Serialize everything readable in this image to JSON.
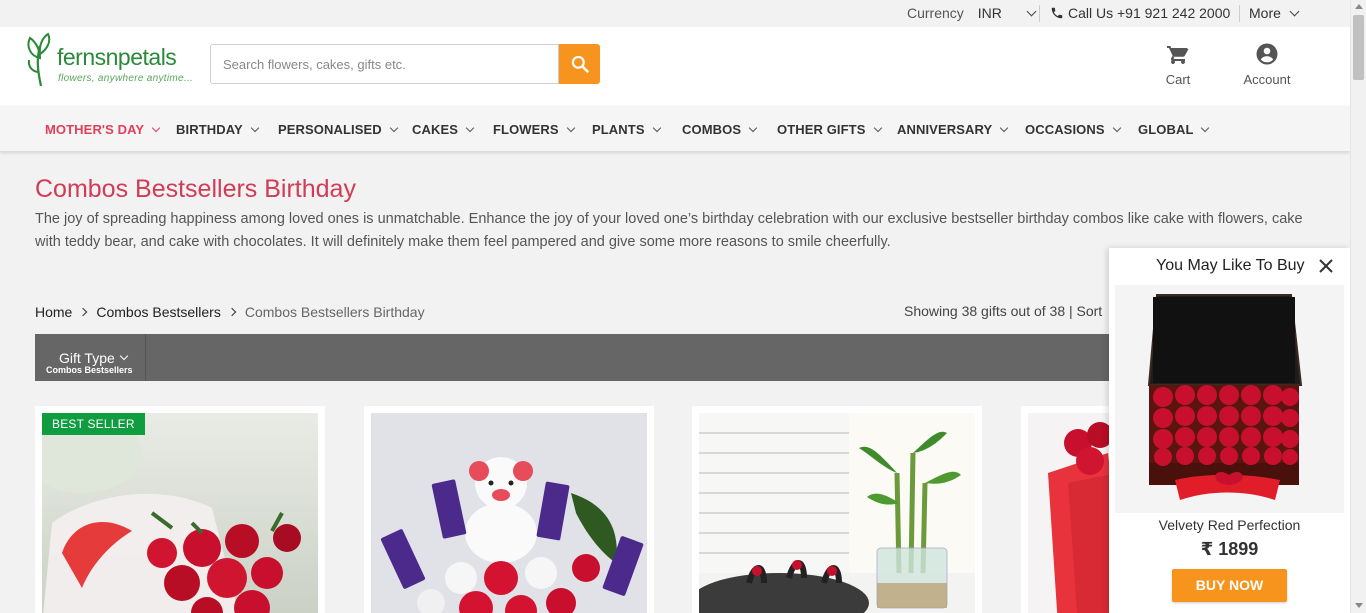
{
  "topbar": {
    "currency_label": "Currency",
    "currency_value": "INR",
    "call_label": "Call Us +91 921 242 2000",
    "more_label": "More"
  },
  "header": {
    "logo_brand": "fernsnpetals",
    "logo_tagline": "flowers, anywhere anytime...",
    "search_placeholder": "Search flowers, cakes, gifts etc.",
    "cart_label": "Cart",
    "account_label": "Account"
  },
  "nav": {
    "items": [
      {
        "label": "MOTHER'S DAY"
      },
      {
        "label": "BIRTHDAY"
      },
      {
        "label": "PERSONALISED"
      },
      {
        "label": "CAKES"
      },
      {
        "label": "FLOWERS"
      },
      {
        "label": "PLANTS"
      },
      {
        "label": "COMBOS"
      },
      {
        "label": "OTHER GIFTS"
      },
      {
        "label": "ANNIVERSARY"
      },
      {
        "label": "OCCASIONS"
      },
      {
        "label": "GLOBAL"
      }
    ]
  },
  "page": {
    "title": "Combos Bestsellers Birthday",
    "description": "The joy of spreading happiness among loved ones is unmatchable. Enhance the joy of your loved one’s birthday celebration with our exclusive bestseller birthday combos like cake with flowers, cake with teddy bear, and cake with chocolates. It will definitely make them feel pampered and give some more reasons to smile cheerfully."
  },
  "breadcrumb": {
    "home": "Home",
    "parent": "Combos Bestsellers",
    "current": "Combos Bestsellers Birthday"
  },
  "results": {
    "showing": "Showing 38 gifts out of 38 |  Sort"
  },
  "filter": {
    "label": "Gift Type",
    "selected": "Combos Bestsellers"
  },
  "products": {
    "badge": "BEST SELLER"
  },
  "popup": {
    "title": "You May Like To Buy",
    "product_name": "Velvety Red Perfection",
    "price": "₹ 1899",
    "buy_label": "BUY NOW"
  },
  "colors": {
    "accent": "#f7941d",
    "brand_red": "#d23b55",
    "brand_green": "#2a8a3a",
    "badge_green": "#0f9d40"
  }
}
